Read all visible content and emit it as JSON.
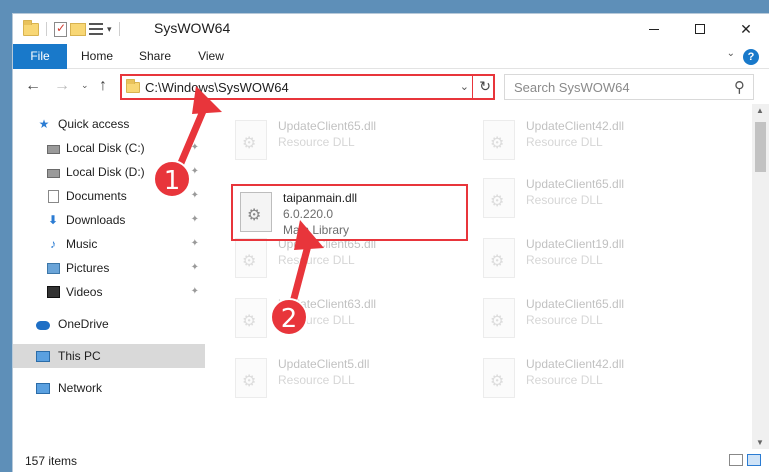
{
  "window": {
    "title": "SysWOW64",
    "controls": {
      "minimize": "minimize",
      "maximize": "maximize",
      "close": "✕"
    }
  },
  "ribbon": {
    "tabs": [
      "File",
      "Home",
      "Share",
      "View"
    ],
    "help": "?",
    "toggle": "⌄"
  },
  "nav": {
    "back": "←",
    "forward": "→",
    "recent": "⌄",
    "up": "↑",
    "address": "C:\\Windows\\SysWOW64",
    "address_dropdown": "⌄",
    "refresh": "↻",
    "search_placeholder": "Search SysWOW64",
    "search_icon": "⚲"
  },
  "sidebar": {
    "items": [
      {
        "label": "Quick access",
        "icon": "star-icon"
      },
      {
        "label": "Local Disk (C:)",
        "icon": "disk-icon",
        "pinned": true
      },
      {
        "label": "Local Disk (D:)",
        "icon": "disk-icon",
        "pinned": true
      },
      {
        "label": "Documents",
        "icon": "documents-icon",
        "pinned": true
      },
      {
        "label": "Downloads",
        "icon": "downloads-icon",
        "pinned": true
      },
      {
        "label": "Music",
        "icon": "music-icon",
        "pinned": true
      },
      {
        "label": "Pictures",
        "icon": "pictures-icon",
        "pinned": true
      },
      {
        "label": "Videos",
        "icon": "videos-icon",
        "pinned": true
      },
      {
        "label": "OneDrive",
        "icon": "onedrive-icon"
      },
      {
        "label": "This PC",
        "icon": "this-pc-icon",
        "selected": true
      },
      {
        "label": "Network",
        "icon": "network-icon"
      }
    ],
    "pin_glyph": "📌"
  },
  "files": {
    "highlighted": {
      "name": "taipanmain.dll",
      "version": "6.0.220.0",
      "type": "Main Library"
    },
    "background": [
      {
        "name": "UpdateClient65.dll",
        "type": "Resource DLL"
      },
      {
        "name": "UpdateClient42.dll",
        "type": "Resource DLL"
      },
      {
        "name": "UpdateClient65.dll",
        "type": "Resource DLL"
      },
      {
        "name": "UpdateClient65.dll",
        "type": "Resource DLL"
      },
      {
        "name": "UpdateClient19.dll",
        "type": "Resource DLL"
      },
      {
        "name": "UpdateClient63.dll",
        "type": "Resource DLL"
      },
      {
        "name": "UpdateClient65.dll",
        "type": "Resource DLL"
      },
      {
        "name": "UpdateClient5.dll",
        "type": "Resource DLL"
      },
      {
        "name": "UpdateClient42.dll",
        "type": "Resource DLL"
      }
    ]
  },
  "status": {
    "item_count": "157 items"
  },
  "annotations": {
    "step1": "1",
    "step2": "2",
    "color": "#e8353b"
  },
  "colors": {
    "accent": "#1979ca",
    "highlight": "#e8353b",
    "selected_bg": "#d9d9d9"
  }
}
